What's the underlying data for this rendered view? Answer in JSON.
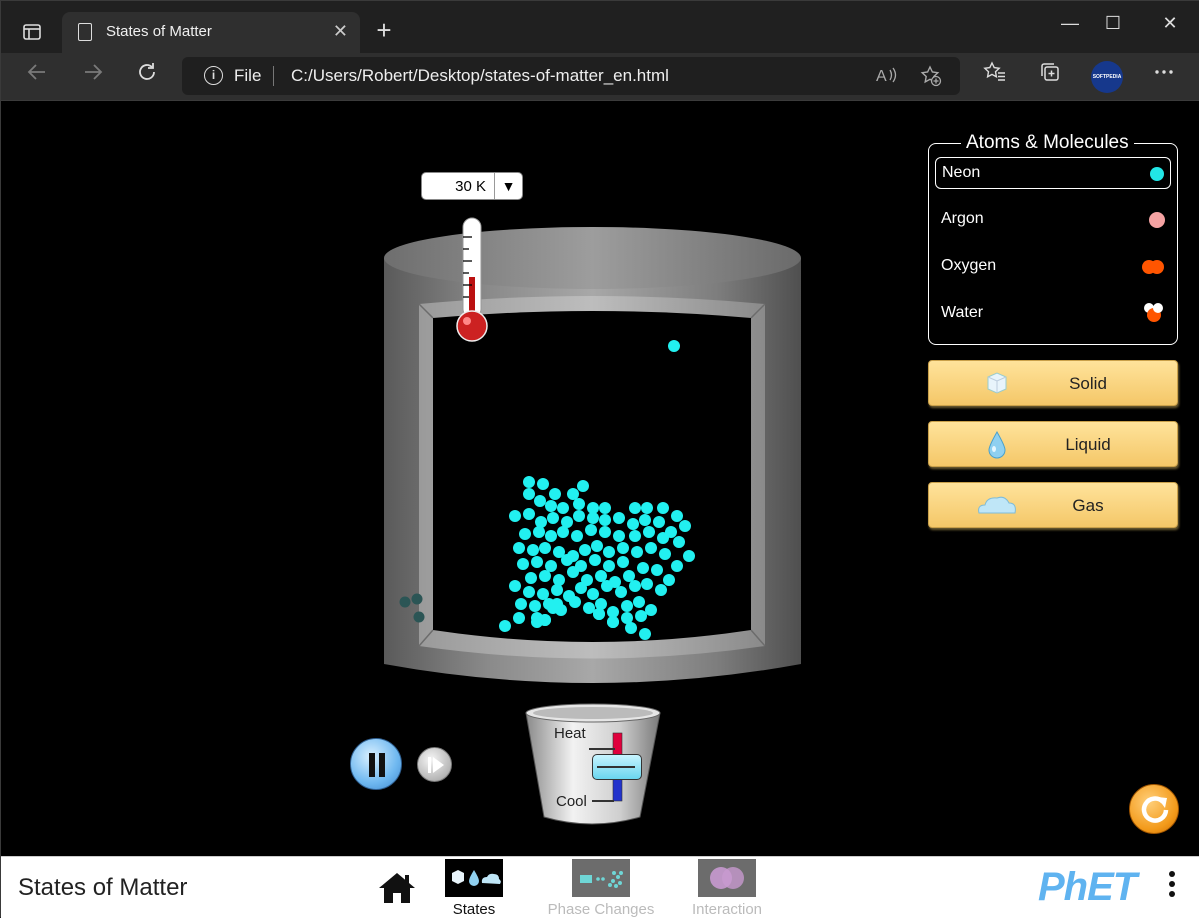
{
  "browser": {
    "tab_title": "States of Matter",
    "tab_close": "✕",
    "new_tab": "+",
    "address_scheme": "File",
    "url": "C:/Users/Robert/Desktop/states-of-matter_en.html",
    "window_controls": [
      "—",
      "☐",
      "✕"
    ],
    "profile_label": "SOFTPEDIA"
  },
  "sim": {
    "temperature_readout": "30 K",
    "dropdown_arrow": "▼",
    "molecules_title": "Atoms & Molecules",
    "molecules": [
      {
        "label": "Neon",
        "color": "#22e6e6",
        "selected": true
      },
      {
        "label": "Argon",
        "color": "#f5a3a3",
        "selected": false
      },
      {
        "label": "Oxygen",
        "color": "#ff5500",
        "selected": false
      },
      {
        "label": "Water",
        "color": "#ff5500",
        "selected": false
      }
    ],
    "phase_buttons": [
      "Solid",
      "Liquid",
      "Gas"
    ],
    "heater": {
      "heat_label": "Heat",
      "cool_label": "Cool",
      "level": 0
    },
    "particle_color": "#22f0f0",
    "paused": false
  },
  "footer": {
    "sim_title": "States of Matter",
    "screens": [
      {
        "label": "States",
        "active": true
      },
      {
        "label": "Phase Changes",
        "active": false
      },
      {
        "label": "Interaction",
        "active": false
      }
    ],
    "brand": "PhET"
  }
}
